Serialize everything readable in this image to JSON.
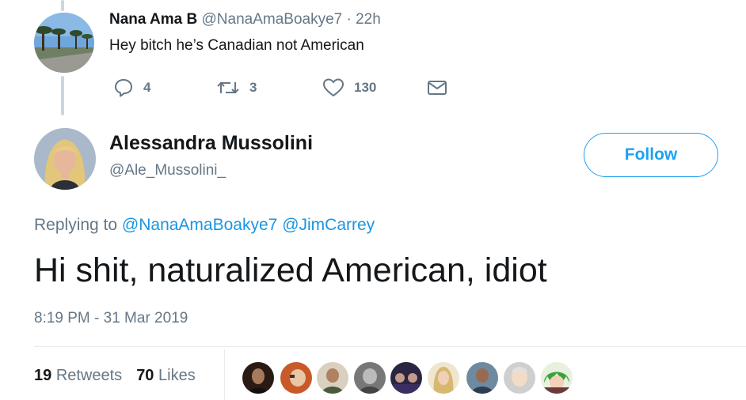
{
  "reply": {
    "name": "Nana Ama B",
    "handle": "@NanaAmaBoakye7",
    "separator": "·",
    "time": "22h",
    "text": "Hey bitch he’s Canadian not American",
    "actions": {
      "replies": "4",
      "retweets": "3",
      "likes": "130"
    }
  },
  "main": {
    "name": "Alessandra Mussolini",
    "handle": "@Ale_Mussolini_",
    "follow_label": "Follow",
    "replying_prefix": "Replying to",
    "replying_to": [
      "@NanaAmaBoakye7",
      "@JimCarrey"
    ],
    "text": "Hi shit, naturalized American, idiot",
    "timestamp": "8:19 PM - 31 Mar 2019",
    "retweet_count": "19",
    "retweet_label": "Retweets",
    "like_count": "70",
    "like_label": "Likes"
  },
  "colors": {
    "accent": "#1da1f2",
    "link": "#1b95e0",
    "muted": "#657786",
    "text": "#14171a",
    "thread_line": "#ccd6dd"
  }
}
